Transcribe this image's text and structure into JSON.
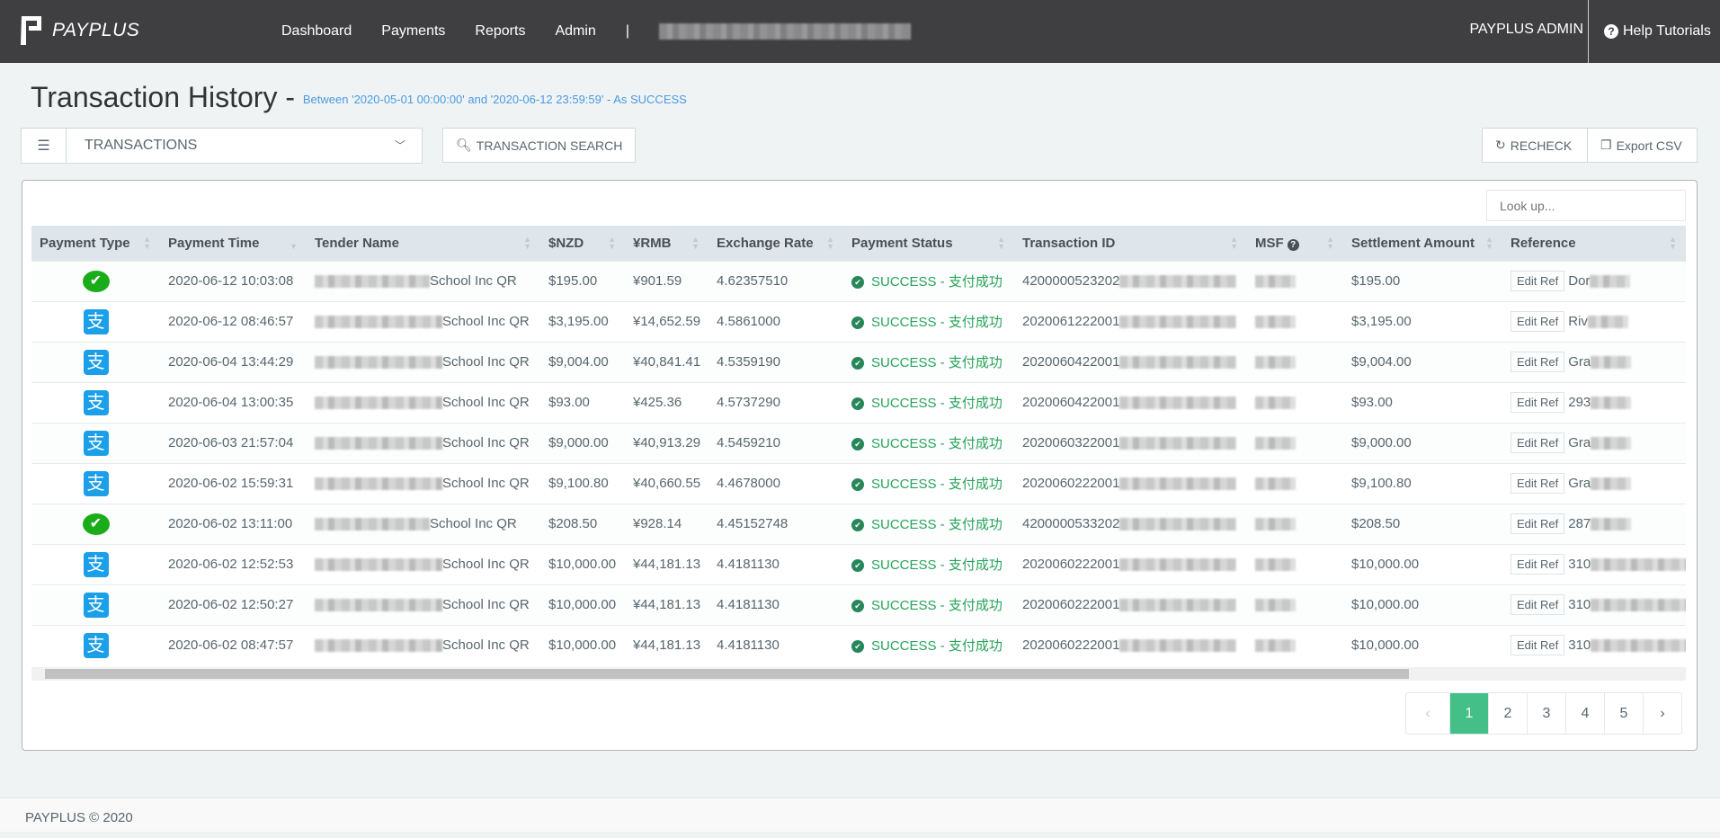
{
  "nav": {
    "brand": "PAYPLUS",
    "links": [
      "Dashboard",
      "Payments",
      "Reports",
      "Admin"
    ],
    "separator": "|",
    "user": "PAYPLUS ADMIN",
    "help": "Help Tutorials"
  },
  "page": {
    "title": "Transaction History -",
    "subtitle": "Between '2020-05-01 00:00:00' and '2020-06-12 23:59:59' - As SUCCESS"
  },
  "toolbar": {
    "select_value": "TRANSACTIONS",
    "search_btn": "TRANSACTION SEARCH",
    "recheck": "RECHECK",
    "export": "Export CSV"
  },
  "lookup_placeholder": "Look up...",
  "columns": [
    "Payment Type",
    "Payment Time",
    "Tender Name",
    "$NZD",
    "¥RMB",
    "Exchange Rate",
    "Payment Status",
    "Transaction ID",
    "MSF",
    "Settlement Amount",
    "Reference"
  ],
  "rows": [
    {
      "type": "wechat",
      "time": "2020-06-12 10:03:08",
      "tender": "School Inc QR",
      "nzd": "$195.00",
      "rmb": "¥901.59",
      "rate": "4.62357510",
      "status": "SUCCESS - 支付成功",
      "txid": "4200000523202",
      "settle": "$195.00",
      "ref": "Dor"
    },
    {
      "type": "alipay",
      "time": "2020-06-12 08:46:57",
      "tender": "School Inc QR",
      "nzd": "$3,195.00",
      "rmb": "¥14,652.59",
      "rate": "4.5861000",
      "status": "SUCCESS - 支付成功",
      "txid": "2020061222001",
      "settle": "$3,195.00",
      "ref": "Riv"
    },
    {
      "type": "alipay",
      "time": "2020-06-04 13:44:29",
      "tender": "School Inc QR",
      "nzd": "$9,004.00",
      "rmb": "¥40,841.41",
      "rate": "4.5359190",
      "status": "SUCCESS - 支付成功",
      "txid": "2020060422001",
      "settle": "$9,004.00",
      "ref": "Gra"
    },
    {
      "type": "alipay",
      "time": "2020-06-04 13:00:35",
      "tender": "School Inc QR",
      "nzd": "$93.00",
      "rmb": "¥425.36",
      "rate": "4.5737290",
      "status": "SUCCESS - 支付成功",
      "txid": "2020060422001",
      "settle": "$93.00",
      "ref": "293"
    },
    {
      "type": "alipay",
      "time": "2020-06-03 21:57:04",
      "tender": "School Inc QR",
      "nzd": "$9,000.00",
      "rmb": "¥40,913.29",
      "rate": "4.5459210",
      "status": "SUCCESS - 支付成功",
      "txid": "2020060322001",
      "settle": "$9,000.00",
      "ref": "Gra"
    },
    {
      "type": "alipay",
      "time": "2020-06-02 15:59:31",
      "tender": "School Inc QR",
      "nzd": "$9,100.80",
      "rmb": "¥40,660.55",
      "rate": "4.4678000",
      "status": "SUCCESS - 支付成功",
      "txid": "2020060222001",
      "settle": "$9,100.80",
      "ref": "Gra"
    },
    {
      "type": "wechat",
      "time": "2020-06-02 13:11:00",
      "tender": "School Inc QR",
      "nzd": "$208.50",
      "rmb": "¥928.14",
      "rate": "4.45152748",
      "status": "SUCCESS - 支付成功",
      "txid": "4200000533202",
      "settle": "$208.50",
      "ref": "287"
    },
    {
      "type": "alipay",
      "time": "2020-06-02 12:52:53",
      "tender": "School Inc QR",
      "nzd": "$10,000.00",
      "rmb": "¥44,181.13",
      "rate": "4.4181130",
      "status": "SUCCESS - 支付成功",
      "txid": "2020060222001",
      "settle": "$10,000.00",
      "ref": "310"
    },
    {
      "type": "alipay",
      "time": "2020-06-02 12:50:27",
      "tender": "School Inc QR",
      "nzd": "$10,000.00",
      "rmb": "¥44,181.13",
      "rate": "4.4181130",
      "status": "SUCCESS - 支付成功",
      "txid": "2020060222001",
      "settle": "$10,000.00",
      "ref": "310"
    },
    {
      "type": "alipay",
      "time": "2020-06-02 08:47:57",
      "tender": "School Inc QR",
      "nzd": "$10,000.00",
      "rmb": "¥44,181.13",
      "rate": "4.4181130",
      "status": "SUCCESS - 支付成功",
      "txid": "2020060222001",
      "settle": "$10,000.00",
      "ref": "310"
    }
  ],
  "edit_ref": "Edit Ref",
  "pagination": {
    "pages": [
      "1",
      "2",
      "3",
      "4",
      "5"
    ],
    "current": "1",
    "prev": "‹",
    "next": "›"
  },
  "footer": "PAYPLUS © 2020",
  "colors": {
    "navbar": "#3f3f41",
    "accent": "#44bf87",
    "success": "#27a35a",
    "wechat": "#1aad19",
    "alipay": "#1a9fe8"
  }
}
